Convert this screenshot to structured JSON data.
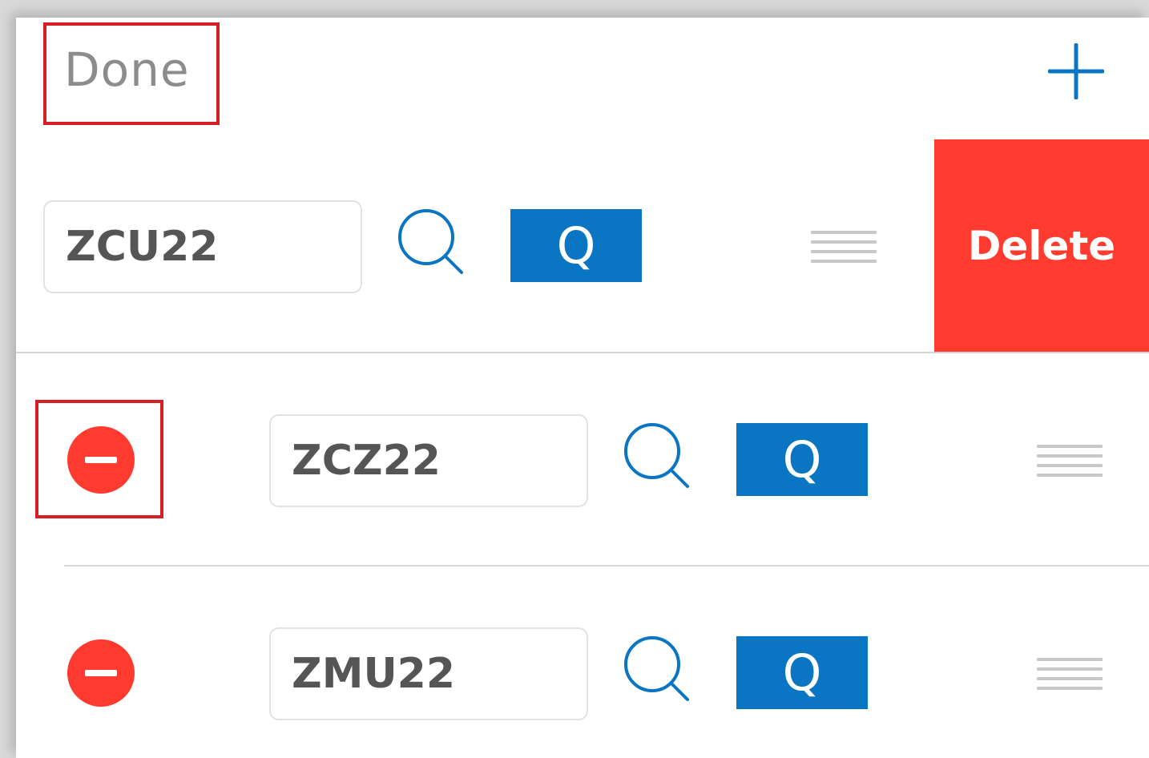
{
  "toolbar": {
    "done_label": "Done"
  },
  "rows": [
    {
      "symbol": "ZCU22",
      "quote_label": "Q"
    },
    {
      "symbol": "ZCZ22",
      "quote_label": "Q"
    },
    {
      "symbol": "ZMU22",
      "quote_label": "Q"
    }
  ],
  "delete_label": "Delete",
  "colors": {
    "accent_blue": "#0a75c2",
    "delete_red": "#ff3b30",
    "highlight_red": "#d61f26"
  },
  "icons": {
    "add": "plus-icon",
    "search": "search-icon",
    "remove": "minus-circle-icon",
    "reorder": "drag-handle-icon"
  }
}
